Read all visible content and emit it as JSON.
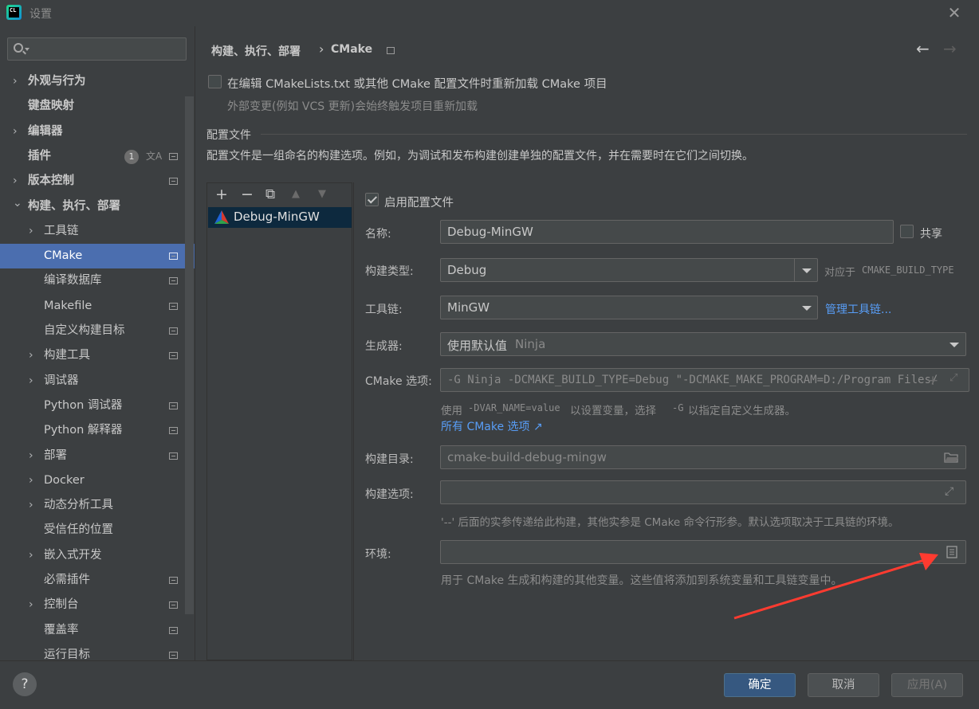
{
  "window": {
    "title": "设置",
    "icon_label": "CL"
  },
  "sidebar": {
    "search_placeholder": "",
    "items": [
      {
        "label": "外观与行为",
        "arrow": "›",
        "indent": 0,
        "page": false
      },
      {
        "label": "键盘映射",
        "arrow": "",
        "indent": 0,
        "page": false
      },
      {
        "label": "编辑器",
        "arrow": "›",
        "indent": 0,
        "page": false
      },
      {
        "label": "插件",
        "arrow": "",
        "indent": 0,
        "page": true,
        "badge": "1"
      },
      {
        "label": "版本控制",
        "arrow": "›",
        "indent": 0,
        "page": true
      },
      {
        "label": "构建、执行、部署",
        "arrow": "⌄",
        "indent": 0,
        "page": false
      },
      {
        "label": "工具链",
        "arrow": "›",
        "indent": 1,
        "page": false
      },
      {
        "label": "CMake",
        "arrow": "",
        "indent": 1,
        "page": true,
        "selected": true
      },
      {
        "label": "编译数据库",
        "arrow": "",
        "indent": 1,
        "page": true
      },
      {
        "label": "Makefile",
        "arrow": "",
        "indent": 1,
        "page": true
      },
      {
        "label": "自定义构建目标",
        "arrow": "",
        "indent": 1,
        "page": true
      },
      {
        "label": "构建工具",
        "arrow": "›",
        "indent": 1,
        "page": true
      },
      {
        "label": "调试器",
        "arrow": "›",
        "indent": 1,
        "page": false
      },
      {
        "label": "Python 调试器",
        "arrow": "",
        "indent": 1,
        "page": true
      },
      {
        "label": "Python 解释器",
        "arrow": "",
        "indent": 1,
        "page": true
      },
      {
        "label": "部署",
        "arrow": "›",
        "indent": 1,
        "page": true
      },
      {
        "label": "Docker",
        "arrow": "›",
        "indent": 1,
        "page": false
      },
      {
        "label": "动态分析工具",
        "arrow": "›",
        "indent": 1,
        "page": false
      },
      {
        "label": "受信任的位置",
        "arrow": "",
        "indent": 1,
        "page": false
      },
      {
        "label": "嵌入式开发",
        "arrow": "›",
        "indent": 1,
        "page": false
      },
      {
        "label": "必需插件",
        "arrow": "",
        "indent": 1,
        "page": true
      },
      {
        "label": "控制台",
        "arrow": "›",
        "indent": 1,
        "page": true
      },
      {
        "label": "覆盖率",
        "arrow": "",
        "indent": 1,
        "page": true
      },
      {
        "label": "运行目标",
        "arrow": "",
        "indent": 1,
        "page": true
      }
    ]
  },
  "header": {
    "breadcrumb_parent": "构建、执行、部署",
    "breadcrumb_sep": "›",
    "breadcrumb_current": "CMake",
    "back": "←",
    "forward": "→"
  },
  "reload": {
    "label": "在编辑 CMakeLists.txt 或其他 CMake 配置文件时重新加载 CMake 项目",
    "hint": "外部变更(例如 VCS 更新)会始终触发项目重新加载"
  },
  "profiles": {
    "section_title": "配置文件",
    "description": "配置文件是一组命名的构建选项。例如，为调试和发布构建创建单独的配置文件，并在需要时在它们之间切换。",
    "toolbar": {
      "add": "+",
      "remove": "−",
      "copy": "⧉",
      "up": "▲",
      "down": "▼"
    },
    "items": [
      "Debug-MinGW"
    ]
  },
  "form": {
    "enable_label": "启用配置文件",
    "name_label": "名称:",
    "name_value": "Debug-MinGW",
    "share_label": "共享",
    "build_type_label": "构建类型:",
    "build_type_value": "Debug",
    "build_type_hint_prefix": "对应于",
    "build_type_hint_var": "CMAKE_BUILD_TYPE",
    "toolchain_label": "工具链:",
    "toolchain_value": "MinGW",
    "toolchain_link": "管理工具链...",
    "generator_label": "生成器:",
    "generator_value": "使用默认值",
    "generator_default": "Ninja",
    "cmake_options_label": "CMake 选项:",
    "cmake_options_value": "-G Ninja -DCMAKE_BUILD_TYPE=Debug \"-DCMAKE_MAKE_PROGRAM=D:/Program Files/",
    "cmake_options_hint_1": "使用",
    "cmake_options_hint_code": "-DVAR_NAME=value",
    "cmake_options_hint_2": "以设置变量，选择",
    "cmake_options_hint_g": "-G",
    "cmake_options_hint_3": "以指定自定义生成器。",
    "all_options_link": "所有 CMake 选项 ↗",
    "build_dir_label": "构建目录:",
    "build_dir_placeholder": "cmake-build-debug-mingw",
    "build_options_label": "构建选项:",
    "build_options_value": "",
    "build_options_hint": "'--' 后面的实参传递给此构建，其他实参是 CMake 命令行形参。默认选项取决于工具链的环境。",
    "env_label": "环境:",
    "env_value": "",
    "env_hint": "用于 CMake 生成和构建的其他变量。这些值将添加到系统变量和工具链变量中。"
  },
  "footer": {
    "help": "?",
    "ok": "确定",
    "cancel": "取消",
    "apply": "应用(A)"
  },
  "colors": {
    "accent": "#4b6eaf",
    "link": "#589df6",
    "annotation": "#ff3b30"
  }
}
